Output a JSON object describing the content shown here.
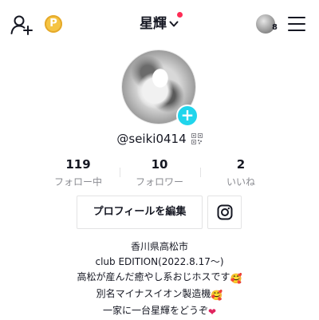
{
  "header": {
    "username": "星輝",
    "coin_symbol": "P",
    "notification_count": "8",
    "colors": {
      "accent_red": "#fe2c55",
      "accent_cyan": "#20d5ec",
      "coin": "#f5c443"
    },
    "icons": [
      "add-user-icon",
      "coin-icon",
      "chevron-down-icon",
      "hamburger-menu-icon"
    ]
  },
  "profile": {
    "avatar_plus_symbol": "+",
    "handle": "@seiki0414",
    "qr_icon": "qr-code-icon"
  },
  "stats": [
    {
      "value": "119",
      "label": "フォロー中"
    },
    {
      "value": "10",
      "label": "フォロワー"
    },
    {
      "value": "2",
      "label": "いいね"
    }
  ],
  "actions": {
    "edit_profile": "プロフィールを編集",
    "instagram_icon": "instagram-icon"
  },
  "bio": {
    "line1": "香川県高松市",
    "line2": "club EDITION(2022.8.17〜)",
    "line3": "高松が産んだ癒やし系おじホスです",
    "line3_emoji": "🥰",
    "line4": "別名マイナスイオン製造機",
    "line4_emoji": "🥰",
    "line5": "一家に一台星輝をどうぞ",
    "line5_emoji": "❤"
  }
}
